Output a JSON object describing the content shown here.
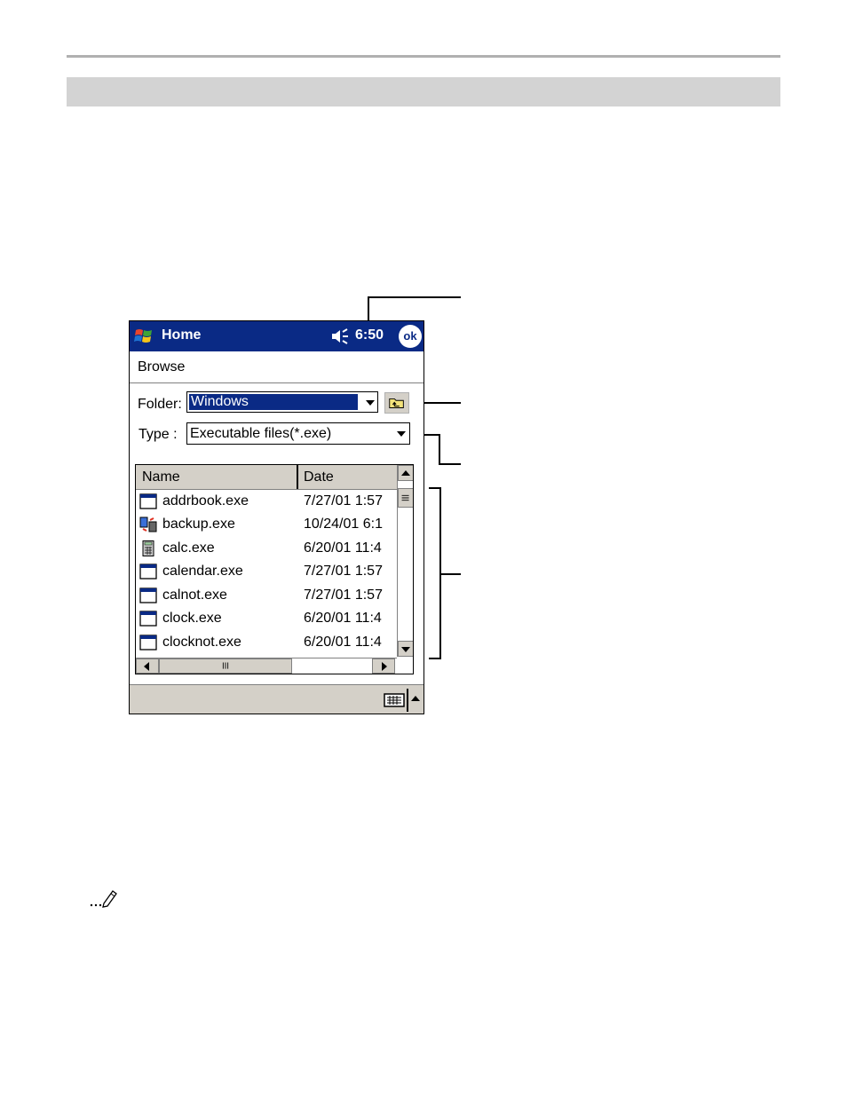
{
  "titlebar": {
    "app_title": "Home",
    "clock": "6:50",
    "ok_label": "ok"
  },
  "dialog": {
    "title": "Browse",
    "folder_label": "Folder:",
    "folder_value": "Windows",
    "type_label": "Type :",
    "type_value": "Executable files(*.exe)"
  },
  "list": {
    "columns": {
      "name": "Name",
      "date": "Date"
    },
    "rows": [
      {
        "name": "addrbook.exe",
        "date": "7/27/01 1:57",
        "icon": "window-icon"
      },
      {
        "name": "backup.exe",
        "date": "10/24/01 6:1",
        "icon": "backup-icon"
      },
      {
        "name": "calc.exe",
        "date": "6/20/01 11:4",
        "icon": "calculator-icon"
      },
      {
        "name": "calendar.exe",
        "date": "7/27/01 1:57",
        "icon": "window-icon"
      },
      {
        "name": "calnot.exe",
        "date": "7/27/01 1:57",
        "icon": "window-icon"
      },
      {
        "name": "clock.exe",
        "date": "6/20/01 11:4",
        "icon": "window-icon"
      },
      {
        "name": "clocknot.exe",
        "date": "6/20/01 11:4",
        "icon": "window-icon"
      }
    ]
  },
  "colors": {
    "titlebar": "#0a2a85",
    "selection": "#0a2a85",
    "chrome": "#d4d0c8"
  }
}
